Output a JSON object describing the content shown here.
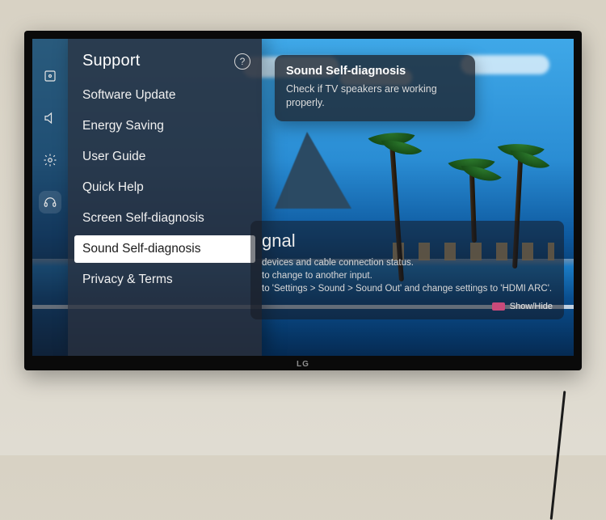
{
  "brand": "LG",
  "rail": {
    "items": [
      {
        "name": "picture-icon",
        "active": false
      },
      {
        "name": "sound-icon",
        "active": false
      },
      {
        "name": "settings-icon",
        "active": false
      },
      {
        "name": "support-icon",
        "active": true
      }
    ]
  },
  "panel": {
    "title": "Support",
    "help_label": "?",
    "items": [
      {
        "label": "Software Update",
        "selected": false
      },
      {
        "label": "Energy Saving",
        "selected": false
      },
      {
        "label": "User Guide",
        "selected": false
      },
      {
        "label": "Quick Help",
        "selected": false
      },
      {
        "label": "Screen Self-diagnosis",
        "selected": false
      },
      {
        "label": "Sound Self-diagnosis",
        "selected": true
      },
      {
        "label": "Privacy & Terms",
        "selected": false
      }
    ]
  },
  "tooltip": {
    "title": "Sound Self-diagnosis",
    "body": "Check if TV speakers are working properly."
  },
  "banner": {
    "heading_suffix": "gnal",
    "line1": "devices and cable connection status.",
    "line2": "to change to another input.",
    "line3": "to 'Settings > Sound > Sound Out' and change settings to 'HDMI ARC'.",
    "show_hide": "Show/Hide"
  }
}
